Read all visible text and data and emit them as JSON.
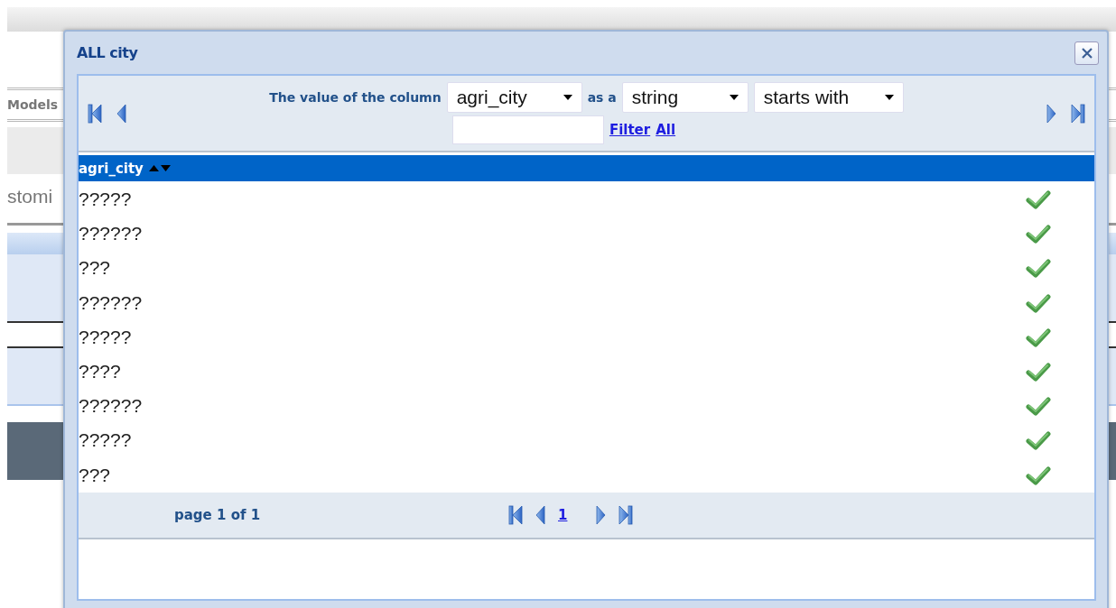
{
  "background": {
    "tab": "Models",
    "label": "stomi"
  },
  "dialog": {
    "title": "ALL city",
    "filter": {
      "prefix": "The value of the column",
      "column": "agri_city",
      "joiner": "as a",
      "type": "string",
      "operator": "starts with",
      "links": [
        "Filter",
        "All"
      ]
    },
    "table": {
      "columns": [
        {
          "label": "agri_city"
        }
      ],
      "rows": [
        {
          "value": "?????",
          "checked": true
        },
        {
          "value": "??????",
          "checked": true
        },
        {
          "value": "???",
          "checked": true
        },
        {
          "value": "??????",
          "checked": true
        },
        {
          "value": "?????",
          "checked": true
        },
        {
          "value": "????",
          "checked": true
        },
        {
          "value": "??????",
          "checked": true
        },
        {
          "value": "?????",
          "checked": true
        },
        {
          "value": "???",
          "checked": true
        }
      ]
    },
    "footer": {
      "page_info": "page 1 of 1",
      "pages": [
        "1"
      ]
    }
  }
}
